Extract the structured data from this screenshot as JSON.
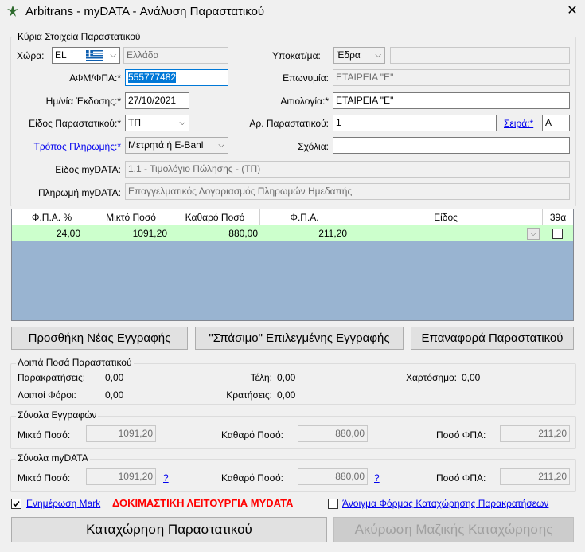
{
  "window": {
    "title": "Arbitrans - myDATA - Ανάλυση Παραστατικού"
  },
  "main": {
    "legend": "Κύρια Στοιχεία Παραστατικού",
    "country_label": "Χώρα:",
    "country_code": "EL",
    "country_name": "Ελλάδα",
    "sub_label": "Υποκατ/μα:",
    "sub_value": "Έδρα",
    "sub_extra": "",
    "afm_label": "ΑΦΜ/ΦΠΑ:*",
    "afm_value": "555777482",
    "name_label": "Επωνυμία:",
    "name_value": "ΕΤΑΙΡΕΙΑ \"Ε\"",
    "date_label": "Ημ/νία Έκδοσης:*",
    "date_value": "27/10/2021",
    "reason_label": "Αιτιολογία:*",
    "reason_value": "ΕΤΑΙΡΕΙΑ \"Ε\"",
    "doctype_label": "Είδος Παραστατικού:*",
    "doctype_value": "ΤΠ",
    "docnum_label": "Αρ. Παραστατικού:",
    "docnum_value": "1",
    "series_label": "Σειρά:*",
    "series_value": "A",
    "payment_label": "Τρόπος Πληρωμής:*",
    "payment_value": "Μετρητά ή E-Banl",
    "comments_label": "Σχόλια:",
    "comments_value": "",
    "mydata_type_label": "Είδος myDATA:",
    "mydata_type_value": "1.1 - Τιμολόγιο Πώλησης - (ΤΠ)",
    "mydata_pay_label": "Πληρωμή myDATA:",
    "mydata_pay_value": "Επαγγελματικός Λογαριασμός Πληρωμών Ημεδαπής"
  },
  "grid": {
    "headers": [
      "Φ.Π.Α. %",
      "Μικτό Ποσό",
      "Καθαρό Ποσό",
      "Φ.Π.Α.",
      "Είδος",
      "39α"
    ],
    "rows": [
      {
        "vat_pct": "24,00",
        "gross": "1091,20",
        "net": "880,00",
        "vat": "211,20",
        "kind": "",
        "a39": false
      }
    ]
  },
  "buttons": {
    "add": "Προσθήκη Νέας Εγγραφής",
    "split": "\"Σπάσιμο\" Επιλεγμένης Εγγραφής",
    "restore": "Επαναφορά Παραστατικού",
    "save": "Καταχώρηση Παραστατικού",
    "cancel_bulk": "Ακύρωση Μαζικής Καταχώρησης"
  },
  "other": {
    "legend": "Λοιπά Ποσά Παραστατικού",
    "withholding_label": "Παρακρατήσεις:",
    "withholding_value": "0,00",
    "fees_label": "Τέλη:",
    "fees_value": "0,00",
    "stamp_label": "Χαρτόσημο:",
    "stamp_value": "0,00",
    "othertax_label": "Λοιποί Φόροι:",
    "othertax_value": "0,00",
    "deductions_label": "Κρατήσεις:",
    "deductions_value": "0,00"
  },
  "totals": {
    "legend": "Σύνολα Εγγραφών",
    "gross_label": "Μικτό Ποσό:",
    "gross_value": "1091,20",
    "net_label": "Καθαρό Ποσό:",
    "net_value": "880,00",
    "vat_label": "Ποσό ΦΠΑ:",
    "vat_value": "211,20"
  },
  "mydata_totals": {
    "legend": "Σύνολα myDATA",
    "gross_label": "Μικτό Ποσό:",
    "gross_value": "1091,20",
    "net_label": "Καθαρό Ποσό:",
    "net_value": "880,00",
    "vat_label": "Ποσό ΦΠΑ:",
    "vat_value": "211,20",
    "help": "?"
  },
  "footer": {
    "update_mark": "Ενημέρωση Mark",
    "update_mark_checked": true,
    "test_mode": "ΔΟΚΙΜΑΣΤΙΚΗ ΛΕΙΤΟΥΡΓΙΑ MYDATA",
    "open_withholding_form": "Άνοιγμα Φόρμας Καταχώρησης Παρακρατήσεων",
    "open_withholding_checked": false
  },
  "colors": {
    "accent": "#0078d7",
    "grid_bg": "#99b4d1",
    "row_bg": "#ccffcc",
    "warning": "#ff0000"
  }
}
